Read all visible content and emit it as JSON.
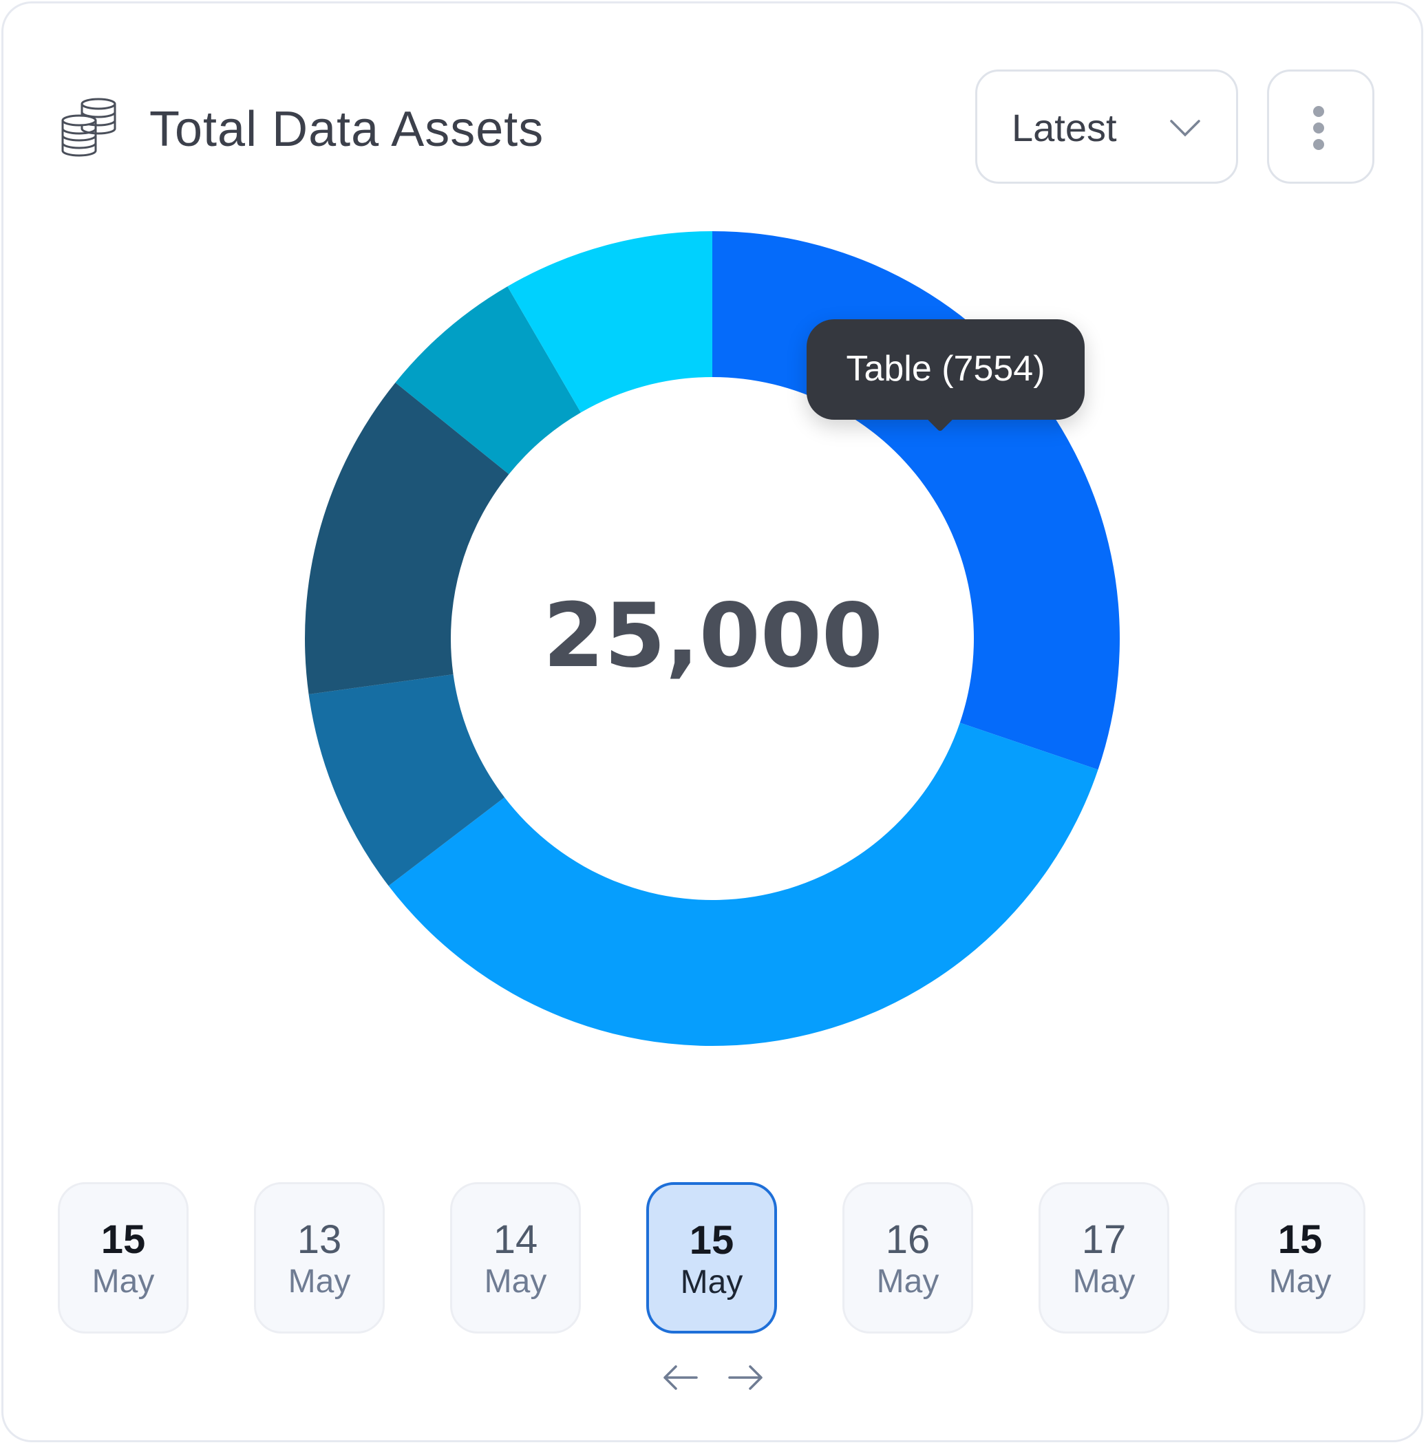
{
  "header": {
    "title": "Total Data Assets",
    "icon": "database-stack-icon"
  },
  "controls": {
    "dropdown_value": "Latest",
    "more_icon": "more-vertical-icon"
  },
  "center_total": "25,000",
  "tooltip": {
    "text": "Table (7554)"
  },
  "chart_data": {
    "type": "pie",
    "variant": "donut",
    "total": 25000,
    "slices": [
      {
        "label": "Table",
        "value": 7554,
        "color": "#056bfa"
      },
      {
        "value": 8600,
        "color": "#069efd"
      },
      {
        "value": 2050,
        "color": "#166ea3"
      },
      {
        "value": 3250,
        "color": "#1d5577"
      },
      {
        "value": 1450,
        "color": "#019fc5"
      },
      {
        "value": 2096,
        "color": "#00d1fe"
      }
    ]
  },
  "dates": [
    {
      "day": "15",
      "month": "May",
      "style": "strong"
    },
    {
      "day": "13",
      "month": "May",
      "style": "normal"
    },
    {
      "day": "14",
      "month": "May",
      "style": "normal"
    },
    {
      "day": "15",
      "month": "May",
      "style": "active"
    },
    {
      "day": "16",
      "month": "May",
      "style": "normal"
    },
    {
      "day": "17",
      "month": "May",
      "style": "normal"
    },
    {
      "day": "15",
      "month": "May",
      "style": "strong"
    }
  ],
  "pager": {
    "prev_icon": "arrow-left-icon",
    "next_icon": "arrow-right-icon"
  }
}
